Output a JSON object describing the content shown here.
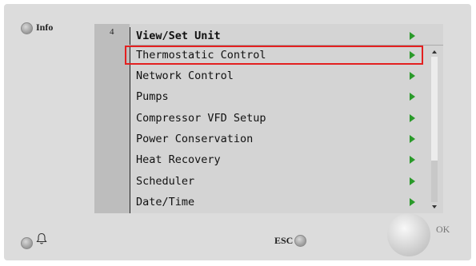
{
  "header": {
    "info_label": "Info",
    "level": "4",
    "title": "View/Set Unit"
  },
  "menu": {
    "items": [
      {
        "label": "Thermostatic Control",
        "selected": true
      },
      {
        "label": "Network Control"
      },
      {
        "label": "Pumps"
      },
      {
        "label": "Compressor VFD Setup"
      },
      {
        "label": "Power Conservation"
      },
      {
        "label": "Heat Recovery"
      },
      {
        "label": "Scheduler"
      },
      {
        "label": "Date/Time"
      }
    ]
  },
  "footer": {
    "esc_label": "ESC",
    "ok_label": "OK",
    "alarm_icon": "bell-icon"
  },
  "colors": {
    "highlight": "#e32020",
    "arrow": "#2a9a2a"
  }
}
